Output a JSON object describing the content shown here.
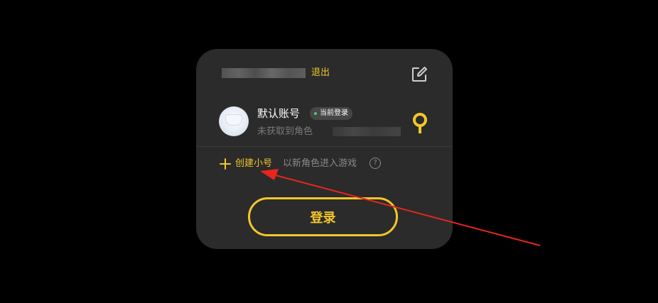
{
  "header": {
    "logout_label": "退出",
    "edit_icon": "edit-icon"
  },
  "account": {
    "name": "默认账号",
    "badge": "当前登录",
    "subtitle": "未获取到角色"
  },
  "create": {
    "link_label": "创建小号",
    "hint": "以新角色进入游戏",
    "help_glyph": "?"
  },
  "login": {
    "label": "登录"
  },
  "colors": {
    "accent": "#f3c62b",
    "card_bg": "#2b2b2b",
    "badge_dot": "#46d17a",
    "annotation_arrow": "#e8261d"
  }
}
